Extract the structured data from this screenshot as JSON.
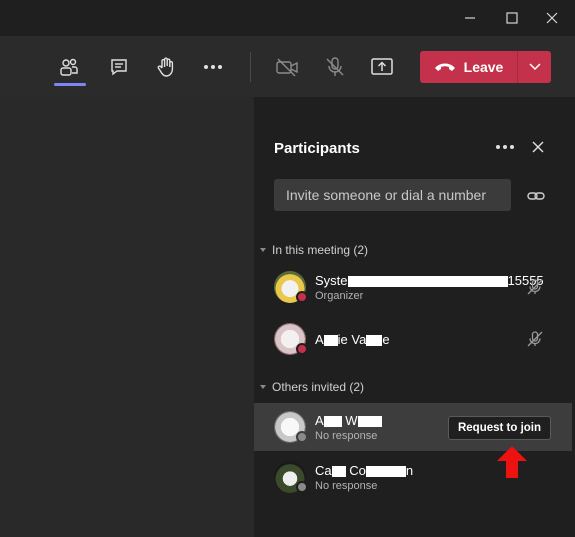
{
  "window": {
    "minimize_icon": "minimize-icon",
    "maximize_icon": "maximize-icon",
    "close_icon": "close-icon"
  },
  "toolbar": {
    "buttons": [
      "people-icon",
      "chat-icon",
      "raise-hand-icon",
      "more-icon",
      "camera-off-icon",
      "mic-off-icon",
      "share-screen-icon"
    ],
    "leave_label": "Leave",
    "accent": "#c4314b"
  },
  "panel": {
    "title": "Participants",
    "invite_placeholder": "Invite someone or dial a number",
    "in_meeting_header": "In this meeting (2)",
    "invited_header": "Others invited (2)",
    "in_meeting": [
      {
        "name_start": "Syste",
        "name_end": "15555",
        "sub": "Organizer",
        "status_color": "#c4314b"
      },
      {
        "name_start": "A",
        "name_mid": "ie Va",
        "name_end": "e",
        "sub": "",
        "status_color": "#c4314b"
      }
    ],
    "invited": [
      {
        "name_start": "A",
        "name_mid": "W",
        "sub": "No response",
        "action": "Request to join"
      },
      {
        "name_start": "Ca",
        "name_mid": "Co",
        "name_end": "n",
        "sub": "No response"
      }
    ]
  }
}
